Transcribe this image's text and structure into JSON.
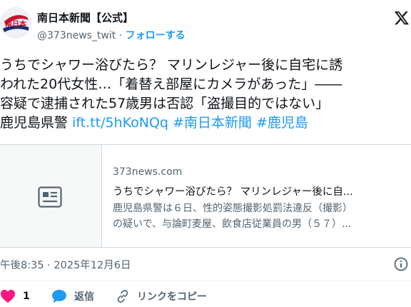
{
  "header": {
    "account_name": "南日本新聞【公式】",
    "handle": "@373news_twit",
    "separator": " · ",
    "follow_label": "フォローする",
    "avatar_text": "南日本"
  },
  "tweet": {
    "lines": [
      {
        "parts": [
          {
            "text": "うちでシャワー浴びたら？ マリンレジャー後に自宅に誘",
            "link": false
          }
        ]
      },
      {
        "parts": [
          {
            "text": "われた20代女性…「着替え部屋にカメラがあった」――",
            "link": false
          }
        ]
      },
      {
        "parts": [
          {
            "text": "容疑で逮捕された57歳男は否認「盗撮目的ではない」",
            "link": false
          }
        ]
      },
      {
        "parts": [
          {
            "text": "鹿児島県警 ",
            "link": false
          },
          {
            "text": "ift.tt/5hKoNQq",
            "link": true
          },
          {
            "text": " ",
            "link": false
          },
          {
            "text": "#南日本新聞",
            "link": true
          },
          {
            "text": " ",
            "link": false
          },
          {
            "text": "#鹿児島",
            "link": true
          }
        ]
      }
    ]
  },
  "card": {
    "domain": "373news.com",
    "title": "うちでシャワー浴びたら？ マリンレジャー後に自...",
    "description_lines": [
      "鹿児島県警は６日、性的姿態撮影処罰法違反（撮影）",
      "の疑いで、与論町麦屋、飲食店従業員の男（５７）..."
    ]
  },
  "meta": {
    "timestamp": "午後8:35 · 2025年12月6日"
  },
  "actions": {
    "like_count": "1",
    "reply_label": "返信",
    "copy_link_label": "リンクをコピー"
  },
  "colors": {
    "accent": "#1d9bf0",
    "like": "#f91880",
    "muted": "#536471",
    "avatar_red": "#c8102e"
  }
}
